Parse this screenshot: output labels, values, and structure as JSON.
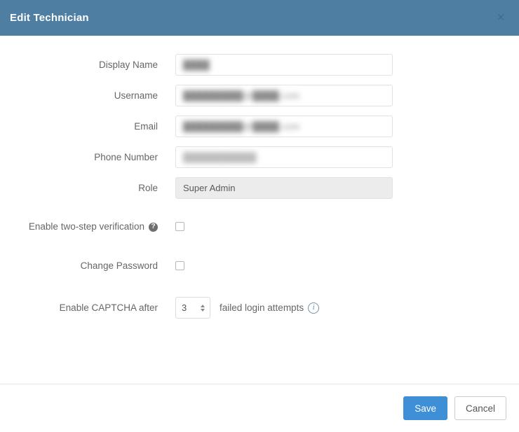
{
  "header": {
    "title": "Edit Technician",
    "close_label": "×",
    "background_color": "#4e7fa3"
  },
  "form": {
    "rows": [
      {
        "label": "Display Name",
        "value": "████"
      },
      {
        "label": "Username",
        "value": "█████████@████.com"
      },
      {
        "label": "Email",
        "value": "█████████@████.com"
      },
      {
        "label": "Phone Number",
        "value": "███████████"
      }
    ],
    "role": {
      "label": "Role",
      "value": "Super Admin"
    },
    "two_step": {
      "label": "Enable two-step verification",
      "help_icon": "question-mark-icon",
      "help_glyph": "?",
      "checked": false
    },
    "change_password": {
      "label": "Change Password",
      "checked": false
    },
    "captcha": {
      "label": "Enable CAPTCHA after",
      "value": "3",
      "suffix": "failed login attempts",
      "info_icon": "info-icon",
      "info_glyph": "i"
    }
  },
  "footer": {
    "save_label": "Save",
    "cancel_label": "Cancel",
    "primary_color": "#3e8fd6"
  }
}
